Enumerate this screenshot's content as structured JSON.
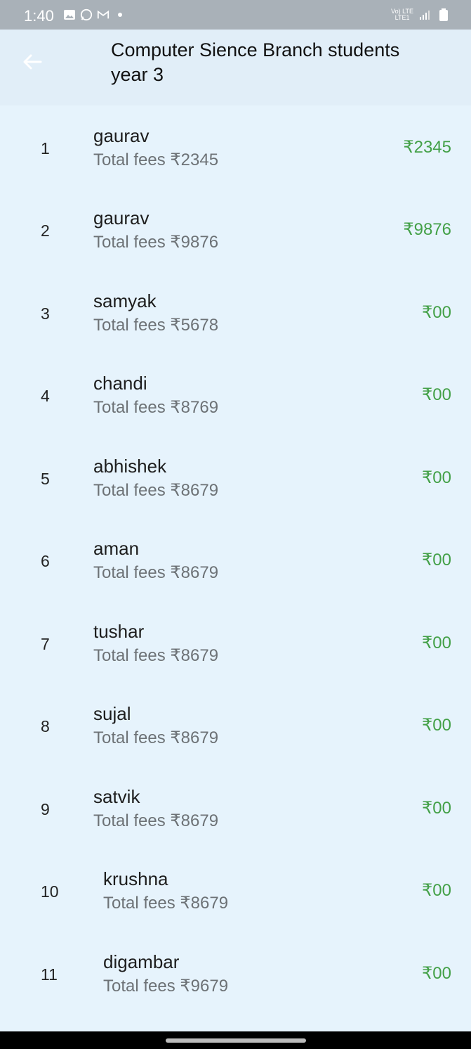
{
  "status_bar": {
    "time": "1:40",
    "left_icons": [
      "gallery-icon",
      "whatsapp-icon",
      "gmail-icon",
      "dot-icon"
    ],
    "network_label_top": "Vo) LTE",
    "network_label_bottom": "LTE1"
  },
  "app_bar": {
    "title": "Computer Sience Branch students year 3",
    "back_icon": "back-arrow-icon"
  },
  "students": [
    {
      "index": "1",
      "name": "gaurav",
      "total": "Total fees ₹2345",
      "paid": "₹2345"
    },
    {
      "index": "2",
      "name": "gaurav",
      "total": "Total fees ₹9876",
      "paid": "₹9876"
    },
    {
      "index": "3",
      "name": "samyak",
      "total": "Total fees ₹5678",
      "paid": "₹00"
    },
    {
      "index": "4",
      "name": "chandi",
      "total": "Total fees ₹8769",
      "paid": "₹00"
    },
    {
      "index": "5",
      "name": "abhishek",
      "total": "Total fees ₹8679",
      "paid": "₹00"
    },
    {
      "index": "6",
      "name": "aman",
      "total": "Total fees ₹8679",
      "paid": "₹00"
    },
    {
      "index": "7",
      "name": "tushar",
      "total": "Total fees ₹8679",
      "paid": "₹00"
    },
    {
      "index": "8",
      "name": "sujal",
      "total": "Total fees ₹8679",
      "paid": "₹00"
    },
    {
      "index": "9",
      "name": "satvik",
      "total": "Total fees ₹8679",
      "paid": "₹00"
    },
    {
      "index": "10",
      "name": "krushna",
      "total": "Total fees ₹8679",
      "paid": "₹00"
    },
    {
      "index": "11",
      "name": "digambar",
      "total": "Total fees ₹9679",
      "paid": "₹00"
    }
  ],
  "colors": {
    "background": "#e6f3fc",
    "app_bar": "#e1eef8",
    "paid_green": "#43a047",
    "status_bar": "#a9b1b8"
  }
}
